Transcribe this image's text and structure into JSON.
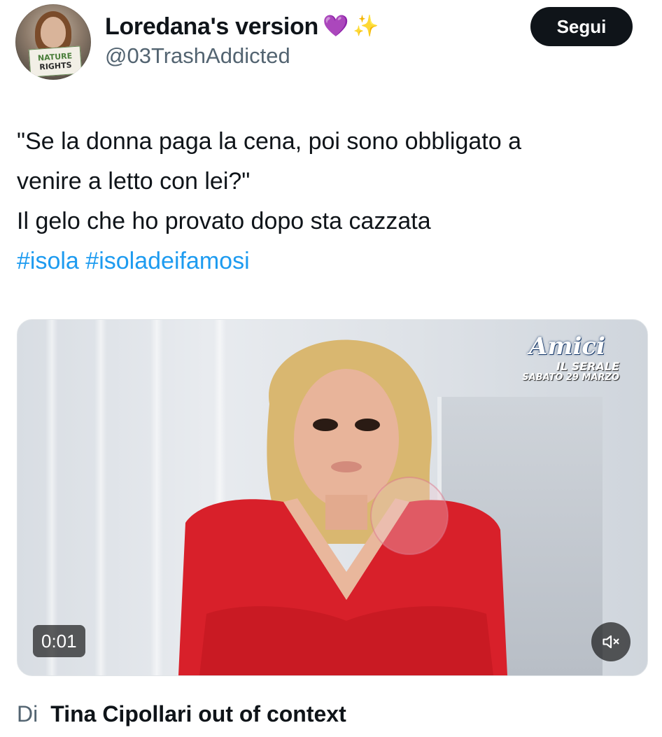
{
  "header": {
    "display_name": "Loredana's version",
    "name_emojis": [
      "💜",
      "✨"
    ],
    "handle": "@03TrashAddicted",
    "follow_label": "Segui",
    "avatar": {
      "sign_line1": "NATURE",
      "sign_line2": "RIGHTS"
    }
  },
  "tweet": {
    "lines": [
      "\"Se la donna paga la cena, poi sono obbligato a",
      "venire a letto con lei?\"",
      "Il gelo che ho provato dopo sta cazzata"
    ],
    "hashtags": [
      "#isola",
      "#isoladeifamosi"
    ]
  },
  "media": {
    "overlay_logo": {
      "brand": "Amici",
      "show": "IL SERALE",
      "date": "SABATO 29 MARZO"
    },
    "timestamp": "0:01",
    "mute_icon": "speaker-muted-icon"
  },
  "attribution": {
    "prefix": "Di",
    "source": "Tina Cipollari out of context"
  },
  "colors": {
    "text": "#0f1419",
    "secondary": "#536471",
    "link": "#1d9bf0",
    "button": "#0f1419"
  }
}
